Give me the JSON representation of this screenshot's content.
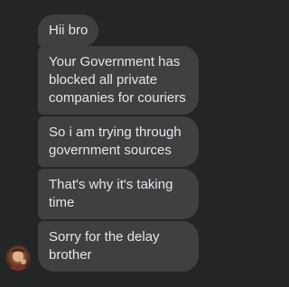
{
  "conversation": {
    "messages": [
      "Hii bro",
      "Your Government has blocked all private companies for couriers",
      "So i am trying through government sources",
      "That's why it's taking time",
      "Sorry for the delay brother"
    ]
  },
  "colors": {
    "background": "#242526",
    "bubble": "#3e4042",
    "text": "#e4e6eb"
  }
}
